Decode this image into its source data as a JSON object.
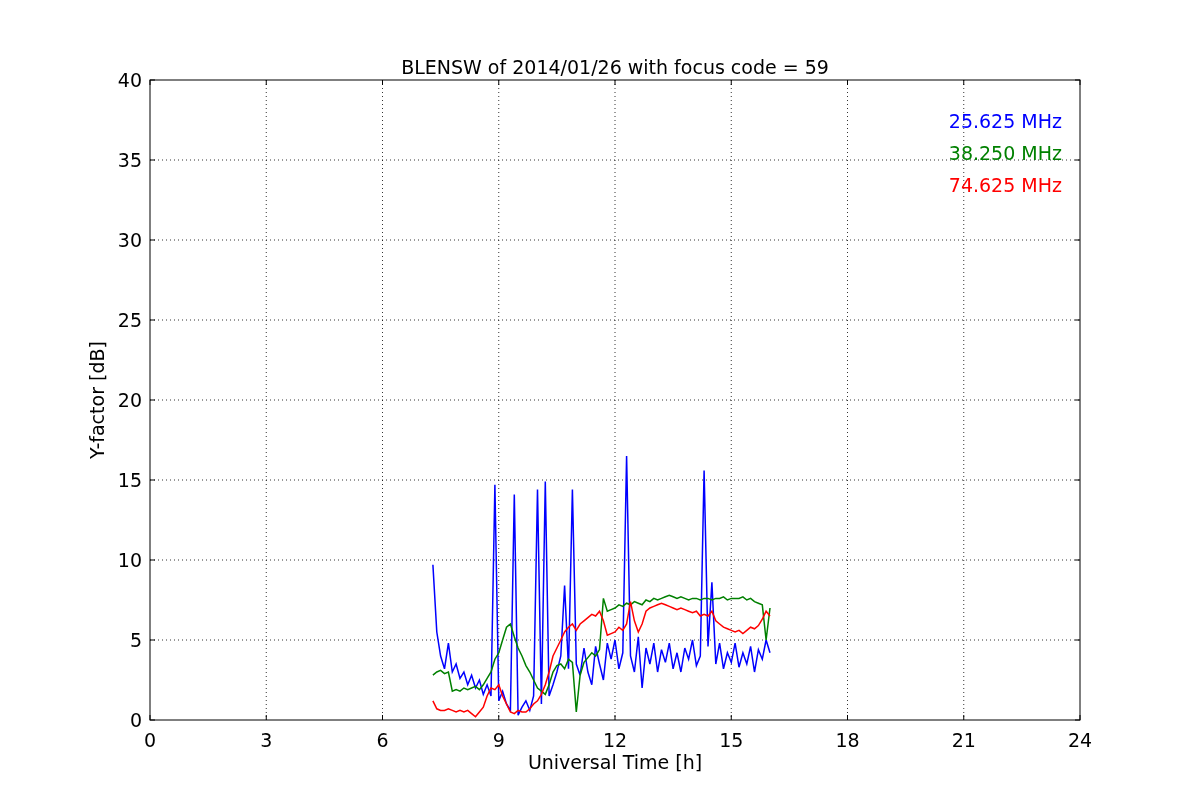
{
  "figure": {
    "chart_data": {
      "type": "line",
      "title": "BLENSW of 2014/01/26 with focus code = 59",
      "xlabel": "Universal Time [h]",
      "ylabel": "Y-factor [dB]",
      "x": [
        7.3,
        7.4,
        7.5,
        7.6,
        7.7,
        7.8,
        7.9,
        8.0,
        8.1,
        8.2,
        8.3,
        8.4,
        8.5,
        8.6,
        8.7,
        8.8,
        8.9,
        9.0,
        9.1,
        9.2,
        9.3,
        9.4,
        9.5,
        9.6,
        9.7,
        9.8,
        9.9,
        10.0,
        10.1,
        10.2,
        10.3,
        10.4,
        10.5,
        10.6,
        10.7,
        10.8,
        10.9,
        11.0,
        11.1,
        11.2,
        11.3,
        11.4,
        11.5,
        11.6,
        11.7,
        11.8,
        11.9,
        12.0,
        12.1,
        12.2,
        12.3,
        12.4,
        12.5,
        12.6,
        12.7,
        12.8,
        12.9,
        13.0,
        13.1,
        13.2,
        13.3,
        13.4,
        13.5,
        13.6,
        13.7,
        13.8,
        13.9,
        14.0,
        14.1,
        14.2,
        14.3,
        14.4,
        14.5,
        14.6,
        14.7,
        14.8,
        14.9,
        15.0,
        15.1,
        15.2,
        15.3,
        15.4,
        15.5,
        15.6,
        15.7,
        15.8,
        15.9,
        16.0
      ],
      "series": [
        {
          "name": "25.625 MHz",
          "color": "#0000ff",
          "values": [
            9.7,
            5.5,
            4.0,
            3.2,
            4.8,
            3.0,
            3.5,
            2.6,
            3.0,
            2.2,
            2.8,
            2.0,
            2.5,
            1.6,
            2.2,
            1.5,
            14.7,
            1.2,
            1.8,
            1.0,
            0.6,
            14.1,
            0.3,
            0.8,
            1.2,
            0.6,
            1.5,
            14.4,
            1.0,
            14.9,
            1.5,
            2.2,
            3.0,
            4.0,
            8.4,
            3.2,
            14.4,
            3.5,
            2.8,
            4.5,
            3.0,
            2.2,
            4.6,
            3.5,
            2.5,
            4.8,
            3.8,
            5.0,
            3.2,
            4.2,
            16.5,
            4.0,
            3.0,
            5.2,
            2.0,
            4.5,
            3.5,
            4.8,
            3.0,
            4.4,
            3.6,
            4.8,
            3.2,
            4.2,
            3.0,
            4.5,
            3.8,
            5.0,
            3.4,
            4.0,
            15.6,
            4.6,
            8.6,
            3.5,
            4.8,
            3.2,
            4.2,
            3.6,
            4.8,
            3.3,
            4.2,
            3.5,
            4.6,
            3.0,
            4.4,
            3.8,
            5.0,
            4.2
          ]
        },
        {
          "name": "38.250 MHz",
          "color": "#008000",
          "values": [
            2.8,
            3.0,
            3.1,
            2.9,
            3.0,
            1.8,
            1.9,
            1.8,
            2.0,
            1.9,
            2.0,
            2.1,
            1.9,
            2.2,
            2.6,
            3.0,
            3.8,
            4.2,
            5.0,
            5.8,
            6.0,
            5.2,
            4.5,
            4.0,
            3.4,
            3.0,
            2.5,
            2.0,
            1.8,
            1.6,
            2.2,
            3.0,
            3.4,
            3.5,
            3.2,
            3.8,
            3.6,
            0.5,
            2.8,
            3.6,
            3.9,
            4.2,
            4.0,
            4.4,
            7.6,
            6.8,
            6.9,
            7.0,
            7.2,
            7.1,
            7.3,
            7.2,
            7.4,
            7.3,
            7.2,
            7.5,
            7.4,
            7.6,
            7.5,
            7.6,
            7.7,
            7.8,
            7.7,
            7.6,
            7.7,
            7.6,
            7.5,
            7.6,
            7.6,
            7.5,
            7.6,
            7.6,
            7.5,
            7.6,
            7.6,
            7.7,
            7.5,
            7.6,
            7.6,
            7.6,
            7.7,
            7.5,
            7.6,
            7.4,
            7.3,
            7.2,
            5.0,
            7.0
          ]
        },
        {
          "name": "74.625 MHz",
          "color": "#ff0000",
          "values": [
            1.2,
            0.7,
            0.6,
            0.6,
            0.7,
            0.6,
            0.5,
            0.6,
            0.5,
            0.6,
            0.4,
            0.2,
            0.5,
            0.8,
            1.5,
            2.0,
            1.9,
            2.2,
            1.5,
            1.0,
            0.5,
            0.4,
            0.6,
            0.5,
            0.5,
            0.7,
            1.0,
            1.2,
            1.6,
            2.2,
            3.0,
            4.0,
            4.5,
            5.0,
            5.5,
            5.8,
            6.0,
            5.6,
            6.0,
            6.2,
            6.4,
            6.6,
            6.5,
            6.8,
            6.2,
            5.3,
            5.4,
            5.5,
            5.8,
            5.6,
            6.0,
            7.4,
            6.2,
            5.5,
            6.0,
            6.8,
            7.0,
            7.1,
            7.2,
            7.3,
            7.2,
            7.1,
            7.0,
            6.9,
            7.0,
            6.9,
            6.8,
            6.7,
            6.8,
            6.5,
            6.6,
            6.5,
            6.8,
            6.2,
            6.0,
            5.8,
            5.7,
            5.6,
            5.5,
            5.6,
            5.4,
            5.6,
            5.8,
            5.7,
            5.9,
            6.3,
            6.8,
            6.5
          ]
        }
      ],
      "xlim": [
        0,
        24
      ],
      "ylim": [
        0,
        40
      ],
      "grid": true,
      "xticks": [
        0,
        3,
        6,
        9,
        12,
        15,
        18,
        21,
        24
      ],
      "yticks": [
        0,
        5,
        10,
        15,
        20,
        25,
        30,
        35,
        40
      ]
    }
  }
}
